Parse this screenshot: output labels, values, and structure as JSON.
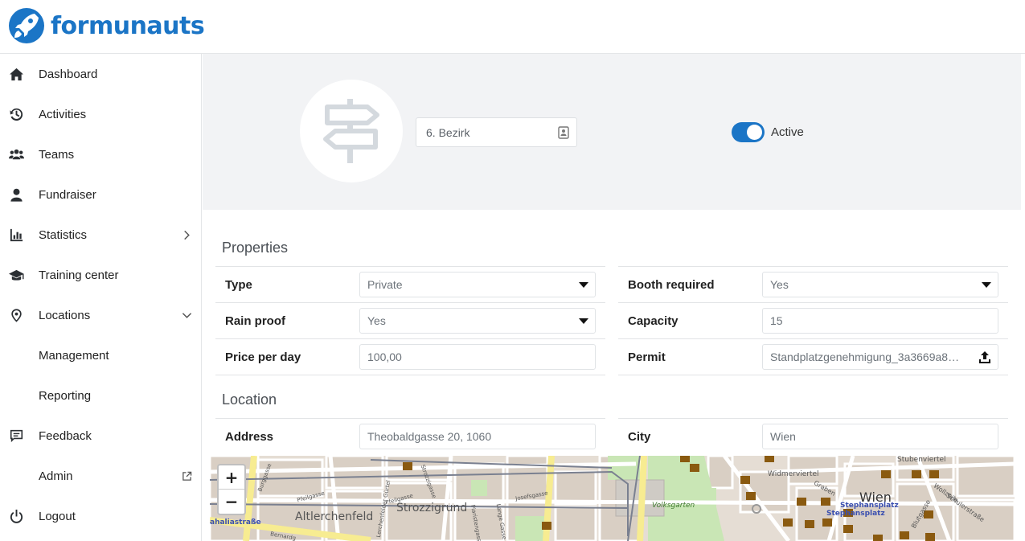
{
  "brand": {
    "name": "formunauts"
  },
  "sidebar": {
    "items": [
      {
        "label": "Dashboard",
        "icon": "home-icon"
      },
      {
        "label": "Activities",
        "icon": "history-icon"
      },
      {
        "label": "Teams",
        "icon": "users-icon"
      },
      {
        "label": "Fundraiser",
        "icon": "user-icon"
      },
      {
        "label": "Statistics",
        "icon": "chart-icon",
        "right": "chevron-right-icon"
      },
      {
        "label": "Training center",
        "icon": "graduation-cap-icon"
      },
      {
        "label": "Locations",
        "icon": "map-pin-icon",
        "right": "chevron-down-icon"
      },
      {
        "label": "Management"
      },
      {
        "label": "Reporting"
      },
      {
        "label": "Feedback",
        "icon": "feedback-icon"
      },
      {
        "label": "Admin",
        "right": "external-link-icon"
      },
      {
        "label": "Logout",
        "icon": "power-icon"
      }
    ]
  },
  "location": {
    "name": "6. Bezirk",
    "active_label": "Active",
    "active": true
  },
  "properties": {
    "title": "Properties",
    "type": {
      "label": "Type",
      "value": "Private"
    },
    "booth_required": {
      "label": "Booth required",
      "value": "Yes"
    },
    "rain_proof": {
      "label": "Rain proof",
      "value": "Yes"
    },
    "capacity": {
      "label": "Capacity",
      "value": "15"
    },
    "price_per_day": {
      "label": "Price per day",
      "value": "100,00"
    },
    "permit": {
      "label": "Permit",
      "value": "Standplatzgenehmigung_3a3669a8…"
    }
  },
  "location_section": {
    "title": "Location",
    "address": {
      "label": "Address",
      "value": "Theobaldgasse 20, 1060"
    },
    "city": {
      "label": "City",
      "value": "Wien"
    }
  },
  "map": {
    "zoom_in": "+",
    "zoom_out": "−",
    "labels": {
      "altlerchenfeld": "Altlerchenfeld",
      "strozzigrund": "Strozzigrund",
      "volksgarten": "Volksgarten",
      "wien": "Wien",
      "stephansplatz_1": "Stephansplatz",
      "stephansplatz_2": "Stephansplatz",
      "widmerviertel": "Widmerviertel",
      "stubenviertel": "Stubenviertel",
      "burggasse": "Burggasse",
      "pfeilgasse": "Pfeilgasse",
      "josefsgasse": "Josefsgasse",
      "lange_gasse": "Lange Gasse",
      "piaristengasse": "Piaristengasse",
      "strozzigasse": "Strozzigasse",
      "lerchenfelder": "Lerchenfelder Gürtel",
      "bernardgasse": "Bernardg",
      "graben": "Graben",
      "wollzeile": "Wollzeile",
      "schulerstrasse": "Schulerstraße",
      "blutgasse": "Blutgasse",
      "halsstrasse": "ahaliastraße"
    }
  }
}
